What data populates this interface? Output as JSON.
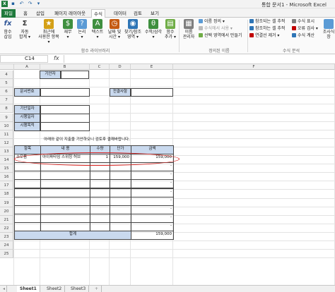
{
  "app": {
    "title": "통합 문서1 - Microsoft Excel",
    "icon": "X"
  },
  "quick_access": [
    {
      "name": "save-icon",
      "glyph": "▪"
    },
    {
      "name": "undo-icon",
      "glyph": "↶"
    },
    {
      "name": "redo-icon",
      "glyph": "↷"
    },
    {
      "name": "dropdown-icon",
      "glyph": "▾"
    }
  ],
  "tabs": [
    "파일",
    "홈",
    "삽입",
    "페이지 레이아웃",
    "수식",
    "데이터",
    "검토",
    "보기"
  ],
  "ribbon": {
    "big_buttons": [
      {
        "name": "insert-function-button",
        "label1": "함수",
        "label2": "삽입",
        "icon": "fx",
        "color": "#2f5597"
      },
      {
        "name": "autosum-button",
        "label1": "자동",
        "label2": "합계 ▾",
        "icon": "Σ",
        "color": "#444444"
      },
      {
        "name": "recent-button",
        "label1": "최근에",
        "label2": "사용한 항목 ▾",
        "icon": "★",
        "color": "#d4a017"
      },
      {
        "name": "financial-button",
        "label1": "재무",
        "label2": "▾",
        "icon": "$",
        "color": "#3f8f3f"
      },
      {
        "name": "logical-button",
        "label1": "논리",
        "label2": "▾",
        "icon": "?",
        "color": "#5b9bd5"
      },
      {
        "name": "text-button",
        "label1": "텍스트",
        "label2": "▾",
        "icon": "A",
        "color": "#3f8f3f"
      },
      {
        "name": "datetime-button",
        "label1": "날짜 및",
        "label2": "시간 ▾",
        "icon": "◷",
        "color": "#c55a11"
      },
      {
        "name": "lookup-button",
        "label1": "찾기/참조",
        "label2": "영역 ▾",
        "icon": "◉",
        "color": "#2e75b6"
      },
      {
        "name": "math-button",
        "label1": "수학/삼각",
        "label2": "▾",
        "icon": "θ",
        "color": "#3f8f3f"
      },
      {
        "name": "more-functions-button",
        "label1": "함수",
        "label2": "추가 ▾",
        "icon": "▤",
        "color": "#70ad47"
      },
      {
        "name": "name-manager-button",
        "label1": "이름",
        "label2": "관리자",
        "icon": "▦",
        "color": "#7f7f7f"
      }
    ],
    "small_buttons_names": [
      "이름 정의 ▾",
      "수식에서 사용 ▾",
      "선택 영역에서 만들기"
    ],
    "small_buttons_audit": [
      "참조되는 셀 추적",
      "참조하는 셀 추적",
      "연결선 제거 ▾"
    ],
    "small_buttons_audit2": [
      "수식 표시",
      "오류 검사 ▾",
      "수식 계산"
    ],
    "last_button": "조사식 창",
    "groups": [
      "함수 라이브러리",
      "정의된 이름",
      "수식 분석"
    ]
  },
  "formula_bar": {
    "name_box": "C14",
    "fx": "fx",
    "formula": ""
  },
  "columns": [
    "A",
    "B",
    "C",
    "D",
    "E",
    "F"
  ],
  "rows": [
    "4",
    "5",
    "6",
    "7",
    "8",
    "9",
    "10",
    "11",
    "12",
    "13",
    "14",
    "15",
    "16",
    "17",
    "18",
    "19",
    "20",
    "21",
    "22",
    "23",
    "24",
    "25"
  ],
  "sheet": {
    "drafter_label": "기안자",
    "doc_no_label": "문서번호",
    "approval_label": "전결사항",
    "draft_date_label": "기안일자",
    "exec_date_label": "시행일자",
    "exec_target_label": "시행목적",
    "notice": "아래와 같이 지출을 기안하오니 검토후 결재바랍니다.",
    "table_headers": [
      "항목",
      "내 용",
      "수량",
      "단가",
      "금액"
    ],
    "item": {
      "category": "소모품",
      "content": "아이파타임 스위칭 허브",
      "qty": "1",
      "unit_price": "159,000",
      "amount": "159,000"
    },
    "empty_amount": "-",
    "total_label": "합계",
    "total": "159,000"
  },
  "sheet_tabs": [
    "Sheet1",
    "Sheet2",
    "Sheet3"
  ],
  "colors": {
    "file_tab": "#1f7a3c",
    "label_fill": "#c9d9ee",
    "highlight": "#d6201d"
  }
}
